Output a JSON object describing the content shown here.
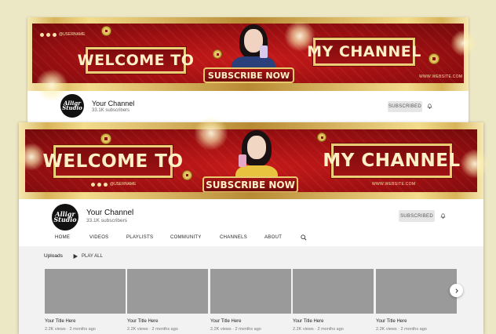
{
  "back_card": {
    "banner": {
      "welcome": "WELCOME TO",
      "my_channel": "MY CHANNEL",
      "subscribe": "SUBSCRIBE NOW",
      "username": "@USERNAME",
      "website": "WWW.WEBSITE.COM"
    },
    "avatar_text": "Alligr Studio",
    "channel_name": "Your Channel",
    "subscribers": "33.1K subscribers",
    "subscribed_label": "SUBSCRIBED"
  },
  "front_card": {
    "banner": {
      "welcome": "WELCOME TO",
      "my_channel": "MY CHANNEL",
      "subscribe": "SUBSCRIBE NOW",
      "username": "@USERNAME",
      "website": "WWW.WEBSITE.COM"
    },
    "avatar_text": "Alligr Studio",
    "channel_name": "Your Channel",
    "subscribers": "33.1K subscribers",
    "subscribed_label": "SUBSCRIBED",
    "nav": {
      "home": "HOME",
      "videos": "VIDEOS",
      "playlists": "PLAYLISTS",
      "community": "COMMUNITY",
      "channels": "CHANNELS",
      "about": "ABOUT"
    },
    "uploads": {
      "heading": "Uploads",
      "play_all": "PLAY ALL",
      "videos": [
        {
          "title": "Your Title Here",
          "meta": "2.2K views · 2 months ago"
        },
        {
          "title": "Your Title Here",
          "meta": "2.2K views · 2 months ago"
        },
        {
          "title": "Your Title Here",
          "meta": "2.2K views · 2 months ago"
        },
        {
          "title": "Your Title Here",
          "meta": "2.2K views · 2 months ago"
        },
        {
          "title": "Your Title Here",
          "meta": "2.2K views · 2 months ago"
        }
      ]
    }
  },
  "colors": {
    "background": "#ece7c4",
    "banner_red": "#9e0f12",
    "gold": "#d8b45a",
    "thumbnail": "#9a9a9a"
  },
  "icons": [
    "instagram-icon",
    "facebook-icon",
    "youtube-icon",
    "bell-icon",
    "search-icon",
    "play-icon",
    "chevron-right-icon"
  ]
}
